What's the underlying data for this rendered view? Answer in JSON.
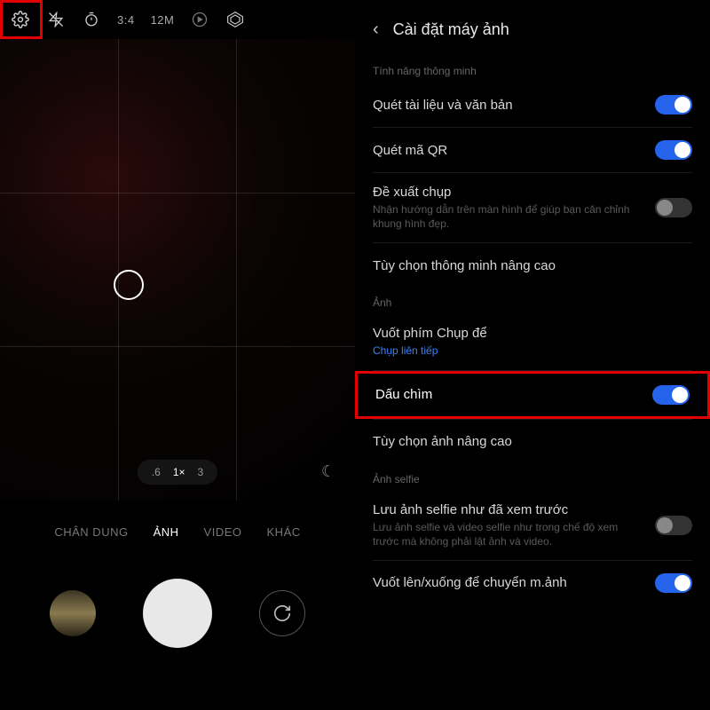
{
  "camera": {
    "toolbar": {
      "aspect": "3:4",
      "resolution": "12M"
    },
    "zoom": {
      "v1": ".6",
      "v2": "1×",
      "v3": "3"
    },
    "modes": {
      "portrait": "CHÂN DUNG",
      "photo": "ẢNH",
      "video": "VIDEO",
      "more": "KHÁC"
    }
  },
  "settings": {
    "title": "Cài đặt máy ảnh",
    "section_smart": "Tính năng thông minh",
    "scan_doc": "Quét tài liệu và văn bản",
    "scan_qr": "Quét mã QR",
    "suggest_title": "Đề xuất chụp",
    "suggest_sub": "Nhận hướng dẫn trên màn hình để giúp bạn căn chỉnh khung hình đẹp.",
    "smart_adv": "Tùy chọn thông minh nâng cao",
    "section_photo": "Ảnh",
    "swipe_shutter": "Vuốt phím Chụp để",
    "swipe_shutter_sub": "Chụp liên tiếp",
    "watermark": "Dấu chìm",
    "photo_adv": "Tùy chọn ảnh nâng cao",
    "section_selfie": "Ảnh selfie",
    "selfie_save": "Lưu ảnh selfie như đã xem trước",
    "selfie_save_sub": "Lưu ảnh selfie và video selfie như trong chế độ xem trước mà không phải lật ảnh và video.",
    "swipe_switch": "Vuốt lên/xuống để chuyển m.ảnh"
  }
}
